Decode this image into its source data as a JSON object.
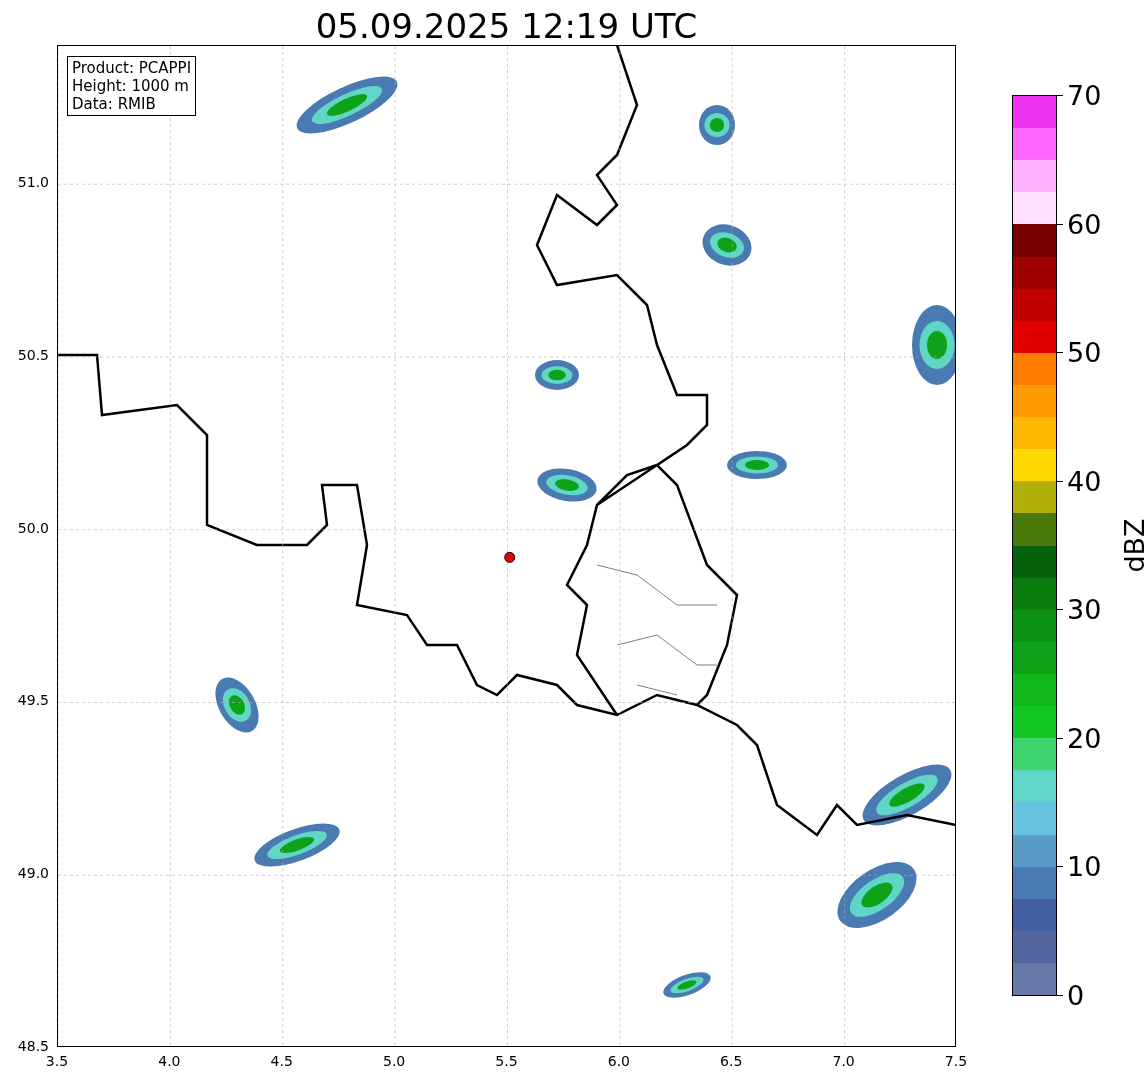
{
  "title": "05.09.2025 12:19 UTC",
  "info_box": {
    "lines": [
      "Product: PCAPPI",
      "Height: 1000 m",
      "Data: RMIB"
    ]
  },
  "map": {
    "chart_data": {
      "type": "scatter",
      "grid": true,
      "xlim": [
        3.5,
        7.5
      ],
      "ylim": [
        48.5,
        51.4
      ],
      "xticks": [
        {
          "value": 3.5,
          "label": "3.5"
        },
        {
          "value": 4.0,
          "label": "4.0"
        },
        {
          "value": 4.5,
          "label": "4.5"
        },
        {
          "value": 5.0,
          "label": "5.0"
        },
        {
          "value": 5.5,
          "label": "5.5"
        },
        {
          "value": 6.0,
          "label": "6.0"
        },
        {
          "value": 6.5,
          "label": "6.5"
        },
        {
          "value": 7.0,
          "label": "7.0"
        },
        {
          "value": 7.5,
          "label": "7.5"
        }
      ],
      "yticks": [
        {
          "value": 48.5,
          "label": "48.5"
        },
        {
          "value": 49.0,
          "label": "49.0"
        },
        {
          "value": 49.5,
          "label": "49.5"
        },
        {
          "value": 50.0,
          "label": "50.0"
        },
        {
          "value": 50.5,
          "label": "50.5"
        },
        {
          "value": 51.0,
          "label": "51.0"
        }
      ],
      "x": [
        5.51
      ],
      "series": [
        {
          "color": "#ee0000",
          "values": [
            49.92
          ]
        }
      ]
    }
  },
  "colorbar": {
    "label": "dBZ",
    "ticks": [
      "70",
      "60",
      "50",
      "40",
      "30",
      "20",
      "10",
      "0"
    ],
    "bands": [
      {
        "color": "#ee33ee"
      },
      {
        "color": "#ff66ff"
      },
      {
        "color": "#ffb0ff"
      },
      {
        "color": "#ffe0ff"
      },
      {
        "color": "#780000"
      },
      {
        "color": "#a00000"
      },
      {
        "color": "#c00000"
      },
      {
        "color": "#e00000"
      },
      {
        "color": "#ff7c00"
      },
      {
        "color": "#ff9a00"
      },
      {
        "color": "#ffb800"
      },
      {
        "color": "#ffd800"
      },
      {
        "color": "#b0b008"
      },
      {
        "color": "#4a780a"
      },
      {
        "color": "#06600c"
      },
      {
        "color": "#0a7c10"
      },
      {
        "color": "#0c9014"
      },
      {
        "color": "#0ea218"
      },
      {
        "color": "#10b81c"
      },
      {
        "color": "#12c820"
      },
      {
        "color": "#3ed46e"
      },
      {
        "color": "#60d6c6"
      },
      {
        "color": "#66c2de"
      },
      {
        "color": "#5a9cc6"
      },
      {
        "color": "#4a7ab2"
      },
      {
        "color": "#4460a2"
      },
      {
        "color": "#5466a0"
      },
      {
        "color": "#6677a8"
      }
    ]
  }
}
